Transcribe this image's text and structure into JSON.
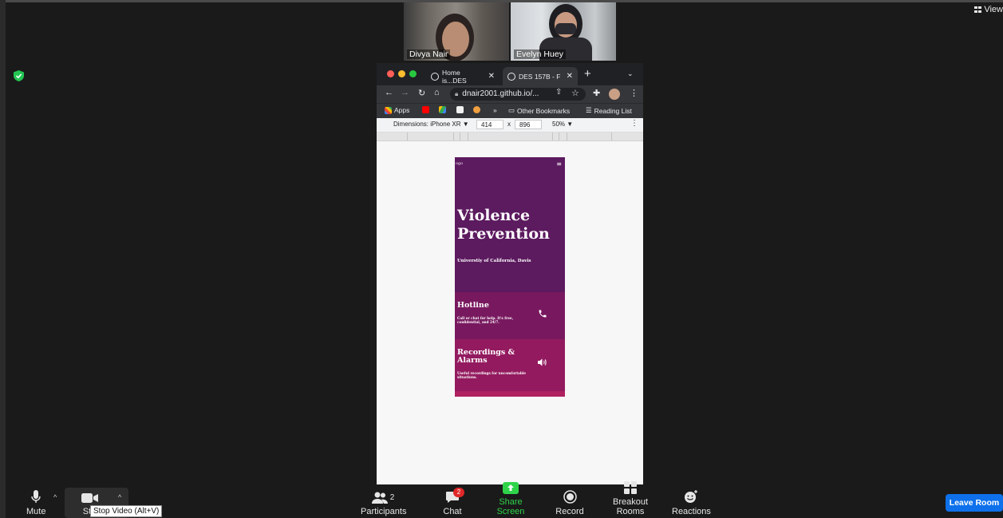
{
  "window": {
    "view_label": "View"
  },
  "participants": [
    {
      "name": "Divya Nair"
    },
    {
      "name": "Evelyn Huey"
    }
  ],
  "browser": {
    "tabs": [
      {
        "label": "Home is...DES",
        "state": "inactive"
      },
      {
        "label": "DES 157B - F",
        "state": "active"
      }
    ],
    "address": "dnair2001.github.io/...",
    "bookmarks": {
      "apps": "Apps",
      "overflow": "»",
      "other": "Other Bookmarks",
      "reading_list": "Reading List"
    },
    "devtools": {
      "dimensions_label": "Dimensions: iPhone XR ▼",
      "width": "414",
      "times": "x",
      "height": "896",
      "zoom": "50% ▼",
      "menu": "⋮"
    }
  },
  "site": {
    "logo": "ogo",
    "hero_title_line1": "Violence",
    "hero_title_line2": "Prevention",
    "hero_subtitle": "Universtiy of California, Davis",
    "cards": [
      {
        "title": "Hotline",
        "desc": "Call or chat for help. It's free, confidential, and 24/7.",
        "icon": "phone-icon"
      },
      {
        "title_line1": "Recordings &",
        "title_line2": "Alarms",
        "desc": "Useful recordings for uncomfortable situations.",
        "icon": "speaker-icon"
      }
    ],
    "colors": {
      "hero": "#5c1a5f",
      "card1": "#78195f",
      "card2": "#931a5f",
      "card3": "#b0215f"
    }
  },
  "toolbar": {
    "mute": "Mute",
    "stop_video": "Sto",
    "tooltip": "Stop Video (Alt+V)",
    "participants": "Participants",
    "participants_count": "2",
    "chat": "Chat",
    "chat_badge": "2",
    "share_screen": "Share Screen",
    "record": "Record",
    "breakout_rooms": "Breakout Rooms",
    "reactions": "Reactions",
    "leave_room": "Leave Room",
    "share_color": "#2fd34a",
    "leave_color": "#0e71eb"
  }
}
